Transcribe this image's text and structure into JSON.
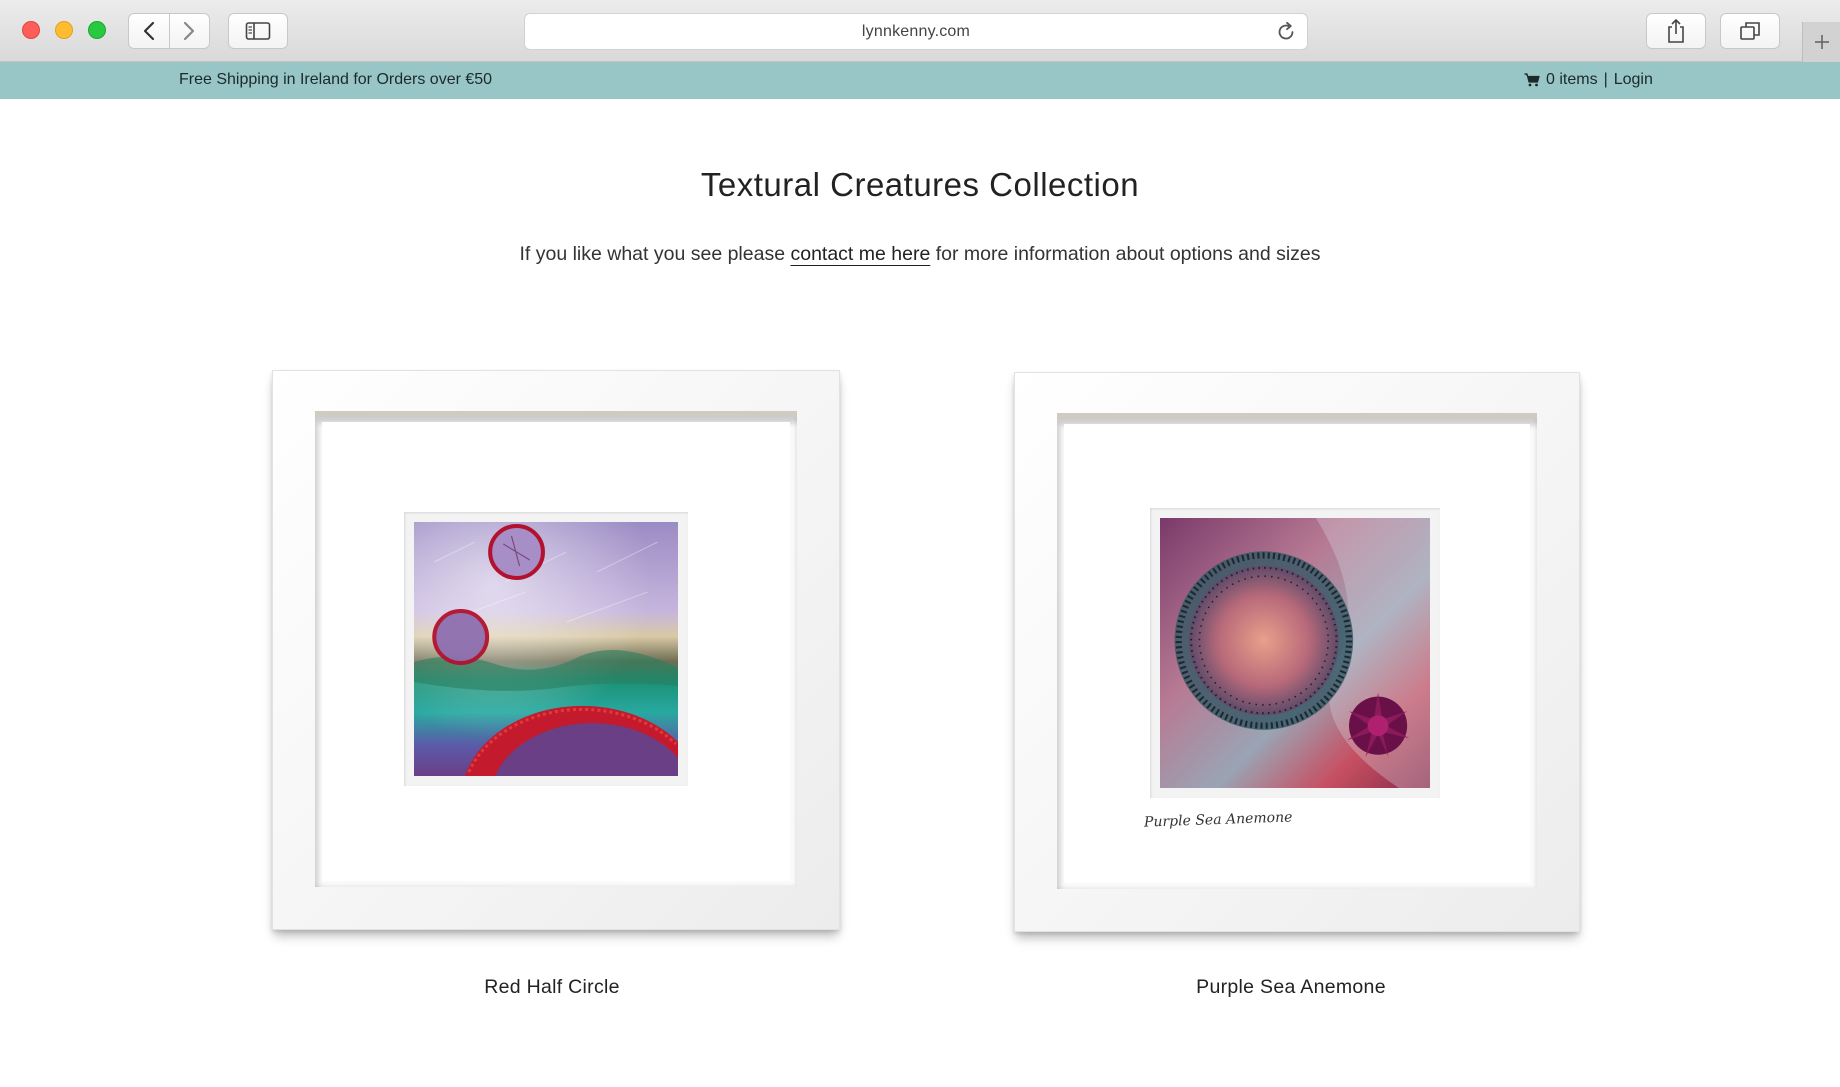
{
  "browser": {
    "url": "lynnkenny.com"
  },
  "promo_bar": {
    "shipping_text": "Free Shipping in Ireland for Orders over €50",
    "cart_text": "0 items",
    "separator": "|",
    "login_text": "Login"
  },
  "main": {
    "title": "Textural Creatures Collection",
    "intro_before": "If you like what you see please ",
    "intro_link": "contact me here",
    "intro_after": " for more information about options and sizes"
  },
  "products": [
    {
      "name": "Red Half Circle"
    },
    {
      "name": "Purple Sea Anemone",
      "signature": "Purple Sea Anemone"
    }
  ],
  "colors": {
    "promo_bar_bg": "#98c5c6",
    "page_bg": "#ffffff"
  },
  "icons": {
    "back": "chevron-left-icon",
    "forward": "chevron-right-icon",
    "sidebar": "sidebar-icon",
    "reload": "reload-icon",
    "share": "share-icon",
    "tabs": "tabs-icon",
    "new_tab": "plus-icon",
    "cart": "cart-icon"
  }
}
